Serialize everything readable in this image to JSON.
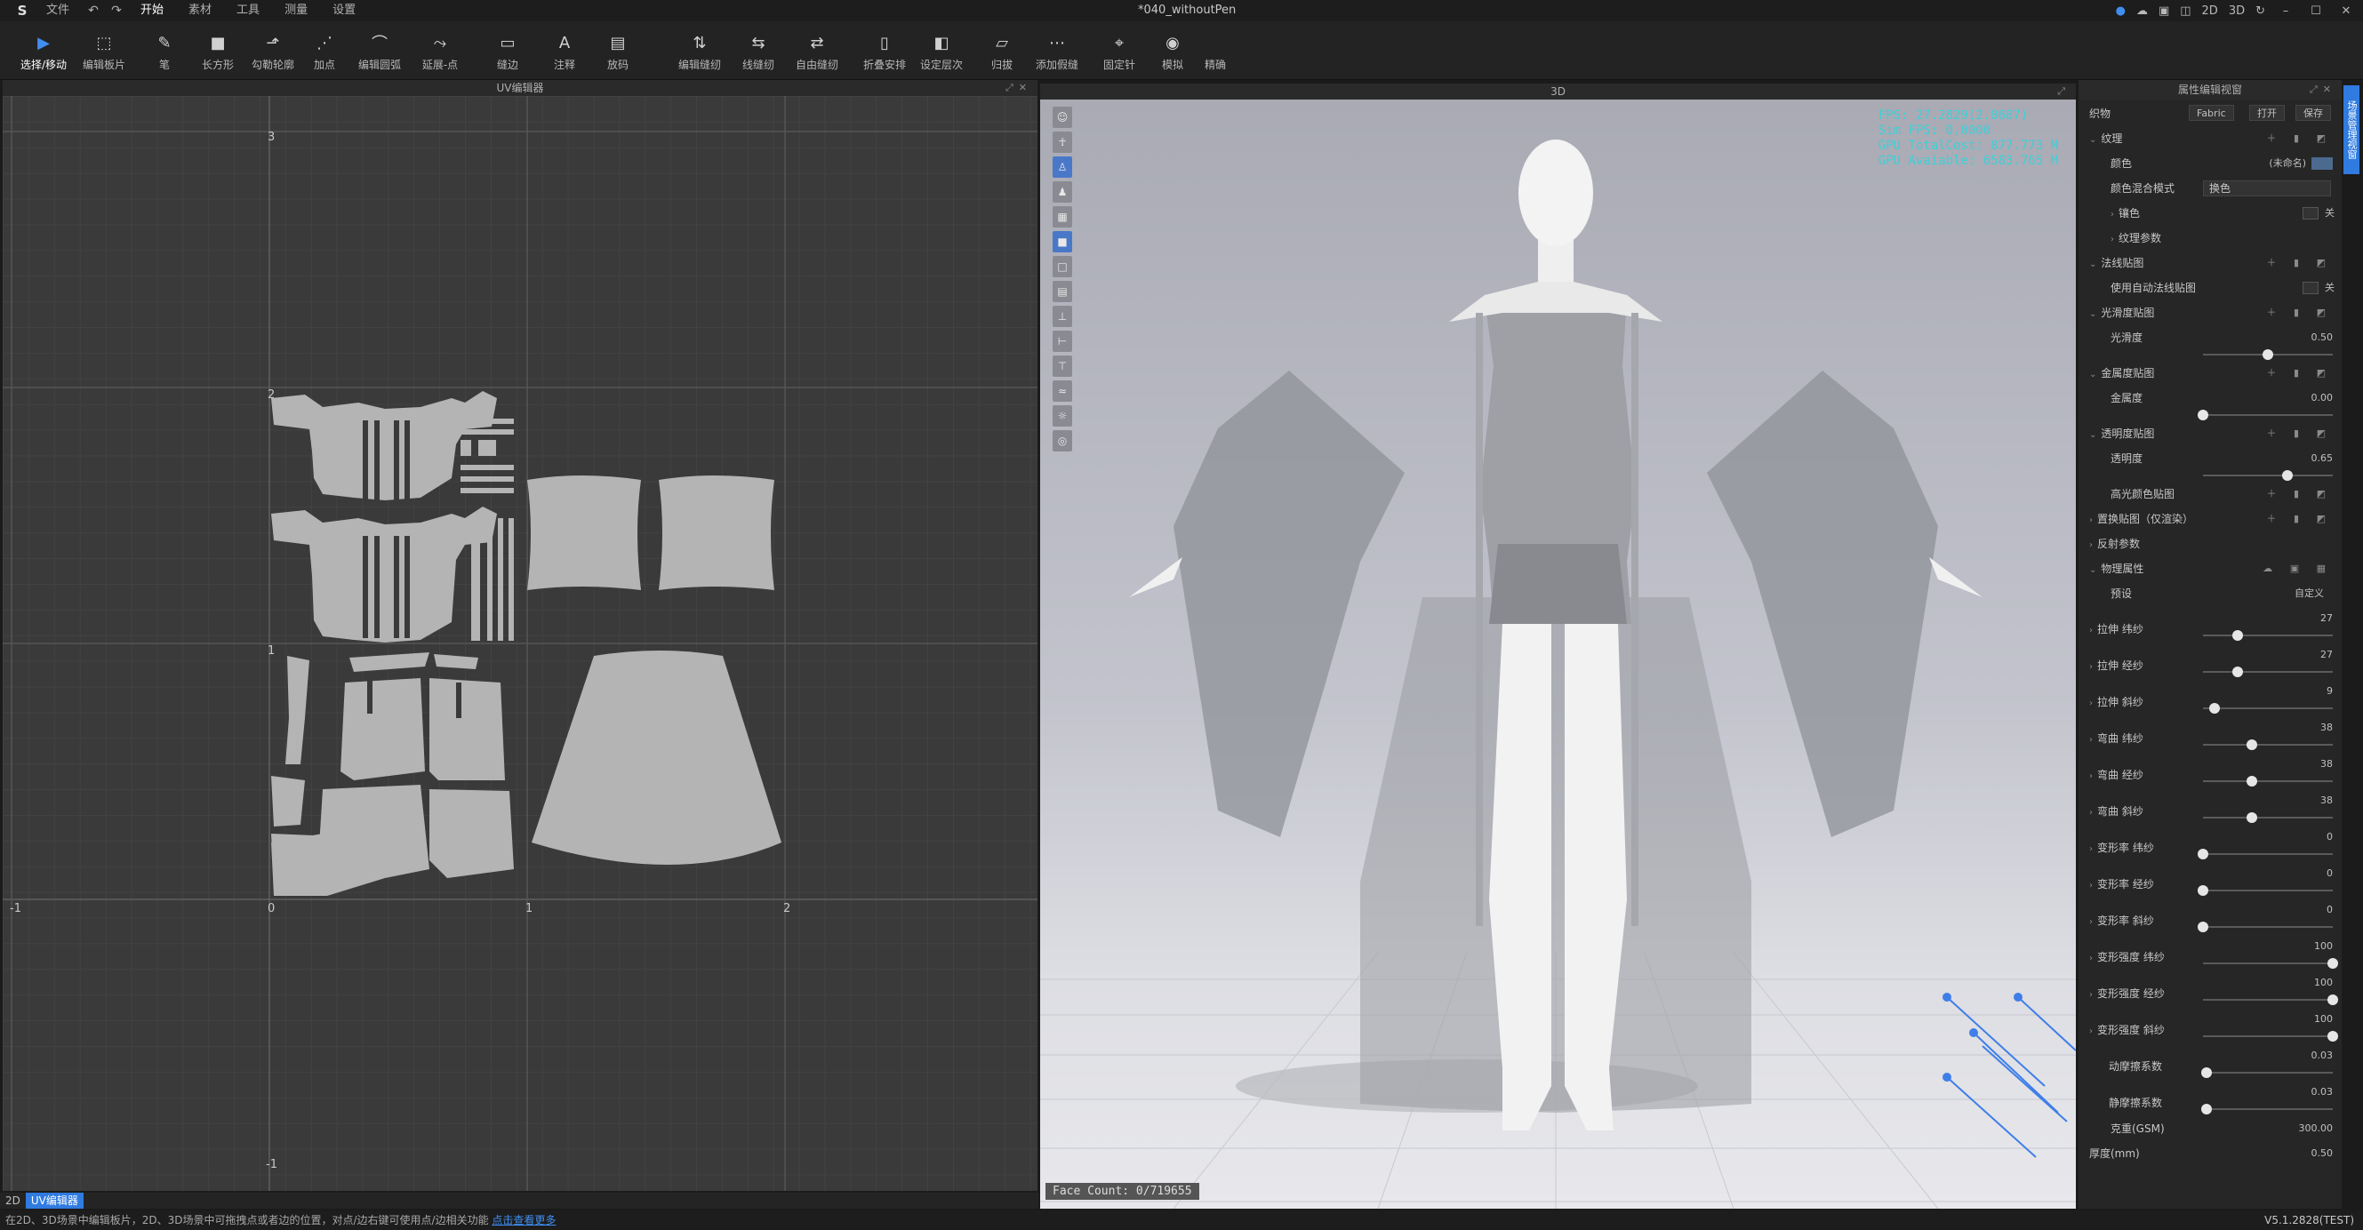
{
  "titlebar": {
    "logo": "S",
    "menus": [
      "文件",
      "开始",
      "素材",
      "工具",
      "测量",
      "设置"
    ],
    "doc_title": "*040_withoutPen",
    "right_items": [
      "2D",
      "3D"
    ]
  },
  "toolbar": {
    "tools": [
      {
        "label": "选择/移动",
        "icon": "▶"
      },
      {
        "label": "编辑板片",
        "icon": "⬚"
      },
      {
        "label": "笔",
        "icon": "✎"
      },
      {
        "label": "长方形",
        "icon": "■"
      },
      {
        "label": "勾勒轮廓",
        "icon": "⬏"
      },
      {
        "label": "加点",
        "icon": "⋰"
      },
      {
        "label": "编辑圆弧",
        "icon": "⌒"
      },
      {
        "label": "延展-点",
        "icon": "⤳"
      },
      {
        "label": "缝边",
        "icon": "▭"
      },
      {
        "label": "注释",
        "icon": "A"
      },
      {
        "label": "放码",
        "icon": "▤"
      },
      {
        "label": "编辑缝纫",
        "icon": "⇅"
      },
      {
        "label": "线缝纫",
        "icon": "⇆"
      },
      {
        "label": "自由缝纫",
        "icon": "⇄"
      },
      {
        "label": "折叠安排",
        "icon": "▯"
      },
      {
        "label": "设定层次",
        "icon": "◧"
      },
      {
        "label": "归拔",
        "icon": "▱"
      },
      {
        "label": "添加假缝",
        "icon": "⋯"
      },
      {
        "label": "固定针",
        "icon": "⌖"
      },
      {
        "label": "模拟",
        "icon": "◉"
      },
      {
        "label": "精确",
        "icon": ""
      }
    ]
  },
  "uv_panel": {
    "title": "UV编辑器",
    "axis_labels": {
      "y3": "3",
      "y2": "2",
      "y1": "1",
      "y_neg1": "-1",
      "x_neg1": "-1",
      "x0": "0",
      "x1": "1",
      "x2": "2"
    }
  },
  "bottom_tabs": [
    {
      "label": "2D",
      "active": false
    },
    {
      "label": "UV编辑器",
      "active": true
    }
  ],
  "view3d": {
    "title": "3D",
    "stats": [
      "FPS: 27.2829(2.8687)",
      "Sim FPS: 0.0000",
      "GPU TotalCost: 877.773 M",
      "GPU Avaiable: 6583.765 M"
    ],
    "face_count": "Face Count: 0/719655"
  },
  "props": {
    "title": "属性编辑视窗",
    "fabric_label": "织物",
    "fabric_type": "Fabric",
    "open_label": "打开",
    "save_label": "保存",
    "vertical_tab": "场景管理视窗",
    "rows": {
      "texture": "纹理",
      "color": "颜色",
      "color_value": "(未命名)",
      "blend_mode": "颜色混合模式",
      "blend_value": "换色",
      "edge_color": "镶色",
      "edge_toggle": "关",
      "texture_params": "纹理参数",
      "normal_map": "法线贴图",
      "auto_normal": "使用自动法线贴图",
      "auto_normal_toggle": "关",
      "gloss_map": "光滑度贴图",
      "gloss": "光滑度",
      "gloss_value": "0.50",
      "metal_map": "金属度贴图",
      "metal": "金属度",
      "metal_value": "0.00",
      "opacity_map": "透明度贴图",
      "opacity": "透明度",
      "opacity_value": "0.65",
      "highlight_map": "高光颜色贴图",
      "displace_map": "置换贴图（仅渲染）",
      "reflect": "反射参数",
      "physics": "物理属性",
      "preset": "预设",
      "preset_value": "自定义",
      "thickness": "厚度(mm)",
      "thickness_value": "0.50",
      "weight": "克重(GSM)",
      "weight_value": "300.00"
    },
    "physics_sliders": [
      {
        "label": "拉伸 纬纱",
        "value": "27",
        "level": 0.27
      },
      {
        "label": "拉伸 经纱",
        "value": "27",
        "level": 0.27
      },
      {
        "label": "拉伸 斜纱",
        "value": "9",
        "level": 0.09
      },
      {
        "label": "弯曲 纬纱",
        "value": "38",
        "level": 0.38
      },
      {
        "label": "弯曲 经纱",
        "value": "38",
        "level": 0.38
      },
      {
        "label": "弯曲 斜纱",
        "value": "38",
        "level": 0.38
      },
      {
        "label": "变形率 纬纱",
        "value": "0",
        "level": 0.0
      },
      {
        "label": "变形率 经纱",
        "value": "0",
        "level": 0.0
      },
      {
        "label": "变形率 斜纱",
        "value": "0",
        "level": 0.0
      },
      {
        "label": "变形强度 纬纱",
        "value": "100",
        "level": 1.0
      },
      {
        "label": "变形强度 经纱",
        "value": "100",
        "level": 1.0
      },
      {
        "label": "变形强度 斜纱",
        "value": "100",
        "level": 1.0
      },
      {
        "label": "动摩擦系数",
        "value": "0.03",
        "level": 0.03
      },
      {
        "label": "静摩擦系数",
        "value": "0.03",
        "level": 0.03
      }
    ]
  },
  "status": {
    "text": "在2D、3D场景中编辑板片，2D、3D场景中可拖拽点或者边的位置，对点/边右键可使用点/边相关功能",
    "link": "点击查看更多",
    "version": "V5.1.2828(TEST)"
  }
}
